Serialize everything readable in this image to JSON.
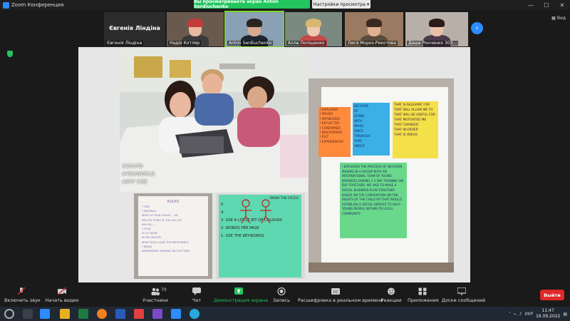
{
  "window": {
    "title": "Zoom Конференция"
  },
  "share_banner": {
    "text": "Вы просматриваете экран Anton Serdiuchenko",
    "view_options": "Настройки просмотра ▾"
  },
  "strip": {
    "active_speaker_big": "Євгенія Ліндіна",
    "participants": [
      {
        "name": "Євгенія Ліндіна"
      },
      {
        "name": "Надія Котляр"
      },
      {
        "name": "Anton Serdiuchenko"
      },
      {
        "name": "Алла Поліщенко"
      },
      {
        "name": "Лися Мороз-Рекотова"
      },
      {
        "name": "Даша Ронченко 303..."
      }
    ],
    "view_label": "Вид"
  },
  "slide": {
    "hashtags": [
      "#20UYD",
      "#YEUWORLD",
      "#EYF COE"
    ],
    "sticky_orange": [
      "I EXPLORED",
      "I PRIVED",
      "I WITNESSED",
      "I REFLECTED",
      "I CONFIRMED",
      "I DISCOVERED",
      "I FELT",
      "I EXPERIENCED"
    ],
    "sticky_blue": [
      "BECAUSE",
      "OF",
      "DOING",
      "WITH",
      "WHILE",
      "SINCE",
      "THROUGH",
      "THAT",
      "ABOUT"
    ],
    "sticky_yellow": [
      "THAT IS RELEVANT FOR",
      "THAT WILL ALLOW ME TO",
      "THAT WILL BE USEFUL FOR",
      "THAT MOTIVATED ME",
      "THAT CHANGED",
      "THAT IN ORDER",
      "THAT IS OREAS"
    ],
    "sticky_green": "I EXPLORED THE PROCESS OF DECISION MAKING IN A GROUP WITH AN INTERNATIONAL TEAM OF YOUNG WORKERS DURING 1 5 DAY TRAINING WE DID TOGETHER. WE HAD TO MAKE A SOCIAL BUSINESS PLAN TOGETHER BASED ON THE CONVENTION ON THE RIGHTS OF THE CHILD OR THAT WOULD ESTABLISH A SOCIAL SERVICE TO HELP YOUNG PEOPLE WITHIN ITS LOCAL COMMUNITY.",
    "rules_title": "RULES",
    "rules_lines": [
      "* TIME",
      "* MATERIAL!",
      "WHAT OF YOUR CHOICE ... OR",
      "SPECIFIC POINT OF THE YOU GOT",
      "ASK YOU ...",
      "* FOOD",
      "AT 14 SHARE",
      "IN THE GROUPS",
      "WHAT YOU'LL HAVE THE PARTICIPANTS",
      "* BREAK",
      "INDEPENDENT SHARING ON STEP TEAM"
    ],
    "green_lines": [
      "5.",
      "4.",
      "3. USE A LITTLE BIT OF COLOURS",
      "2. WORDS PER PAGE",
      "1. USE THE KEYWORDS",
      "DRAW THE FACES!"
    ]
  },
  "toolbar": {
    "items": [
      {
        "id": "audio",
        "label": "Включить звук"
      },
      {
        "id": "video",
        "label": "Начать видео"
      },
      {
        "id": "participants",
        "label": "Участники",
        "count": "70"
      },
      {
        "id": "chat",
        "label": "Чат"
      },
      {
        "id": "share",
        "label": "Демонстрация экрана"
      },
      {
        "id": "record",
        "label": "Запись"
      },
      {
        "id": "captions",
        "label": "Расшифровка в реальном времени"
      },
      {
        "id": "reactions",
        "label": "Реакции"
      },
      {
        "id": "apps",
        "label": "Приложения"
      },
      {
        "id": "whiteboard",
        "label": "Доски сообщений"
      }
    ],
    "leave_label": "Выйти"
  },
  "taskbar": {
    "lang": "УКР",
    "time": "11:47",
    "date": "16.09.2022"
  },
  "colors": {
    "accent": "#2d8cff",
    "share_green": "#23c55e",
    "leave_red": "#e02828"
  }
}
